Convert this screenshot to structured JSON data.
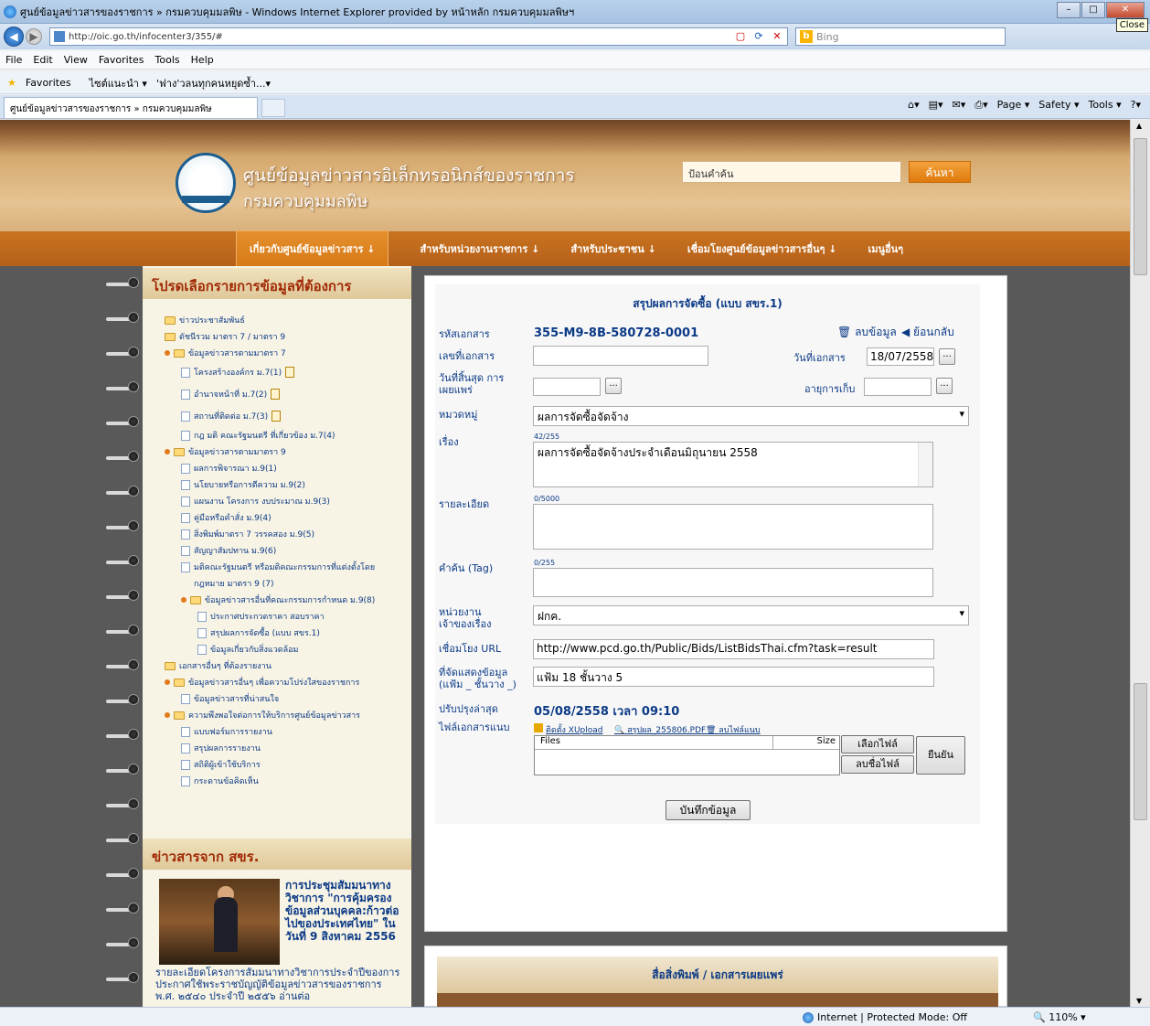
{
  "browser": {
    "window_title": "ศูนย์ข้อมูลข่าวสารของราชการ » กรมควบคุมมลพิษ - Windows Internet Explorer provided by หน้าหลัก กรมควบคุมมลพิษฯ",
    "url": "http://oic.go.th/infocenter3/355/#",
    "search_engine": "Bing",
    "close_tooltip": "Close",
    "menu": [
      "File",
      "Edit",
      "View",
      "Favorites",
      "Tools",
      "Help"
    ],
    "favorites_label": "Favorites",
    "fav_items": [
      "ไซต์แนะนำ ▾",
      "'ฟาง'วลนทุกคนหยุดซ้ำ...▾"
    ],
    "tab_title": "ศูนย์ข้อมูลข่าวสารของราชการ » กรมควบคุมมลพิษ",
    "commands": [
      "Page ▾",
      "Safety ▾",
      "Tools ▾"
    ],
    "status": "Internet | Protected Mode: Off",
    "zoom": "110%"
  },
  "site": {
    "name_line1": "ศูนย์ข้อมูลข่าวสารอิเล็กทรอนิกส์ของราชการ",
    "name_line2": "กรมควบคุมมลพิษ",
    "search_placeholder": "ป้อนคำค้น",
    "search_button": "ค้นหา",
    "nav": [
      "เกี่ยวกับศูนย์ข้อมูลข่าวสาร ↓",
      "สำหรับหน่วยงานราชการ ↓",
      "สำหรับประชาชน ↓",
      "เชื่อมโยงศูนย์ข้อมูลข่าวสารอื่นๆ ↓",
      "เมนูอื่นๆ"
    ]
  },
  "sidebar": {
    "heading": "โปรดเลือกรายการข้อมูลที่ต้องการ",
    "tree": [
      {
        "label": "ข่าวประชาสัมพันธ์",
        "kind": "folder",
        "indent": 0
      },
      {
        "label": "ดัชนีรวม มาตรา 7 / มาตรา 9",
        "kind": "folder",
        "indent": 0
      },
      {
        "label": "ข้อมูลข่าวสารตามมาตรา 7",
        "kind": "folder-open",
        "indent": 0
      },
      {
        "label": "โครงสร้างองค์กร ม.7(1)",
        "kind": "doc",
        "indent": 1,
        "new": true
      },
      {
        "label": "อำนาจหน้าที่ ม.7(2)",
        "kind": "doc",
        "indent": 1,
        "new": true
      },
      {
        "label": "สถานที่ติดต่อ ม.7(3)",
        "kind": "doc",
        "indent": 1,
        "new": true
      },
      {
        "label": "กฎ มติ คณะรัฐมนตรี ที่เกี่ยวข้อง ม.7(4)",
        "kind": "doc",
        "indent": 1
      },
      {
        "label": "ข้อมูลข่าวสารตามมาตรา 9",
        "kind": "folder-open",
        "indent": 0
      },
      {
        "label": "ผลการพิจารณา ม.9(1)",
        "kind": "doc",
        "indent": 1
      },
      {
        "label": "นโยบายหรือการตีความ ม.9(2)",
        "kind": "doc",
        "indent": 1
      },
      {
        "label": "แผนงาน โครงการ งบประมาณ ม.9(3)",
        "kind": "doc",
        "indent": 1
      },
      {
        "label": "คู่มือหรือคำสั่ง ม.9(4)",
        "kind": "doc",
        "indent": 1
      },
      {
        "label": "สิ่งพิมพ์มาตรา 7 วรรคสอง ม.9(5)",
        "kind": "doc",
        "indent": 1
      },
      {
        "label": "สัญญาสัมปทาน ม.9(6)",
        "kind": "doc",
        "indent": 1
      },
      {
        "label": "มติคณะรัฐมนตรี หรือมติคณะกรรมการที่แต่งตั้งโดย",
        "kind": "doc",
        "indent": 1
      },
      {
        "label": "กฎหมาย มาตรา 9 (7)",
        "kind": "text",
        "indent": 1
      },
      {
        "label": "ข้อมูลข่าวสารอื่นที่คณะกรรมการกำหนด ม.9(8)",
        "kind": "folder-open",
        "indent": 1
      },
      {
        "label": "ประกาศประกวดราคา สอบราคา",
        "kind": "doc",
        "indent": 2
      },
      {
        "label": "สรุปผลการจัดซื้อ (แบบ สขร.1)",
        "kind": "doc",
        "indent": 2
      },
      {
        "label": "ข้อมูลเกี่ยวกับสิ่งแวดล้อม",
        "kind": "doc",
        "indent": 2
      },
      {
        "label": "เอกสารอื่นๆ ที่ต้องรายงาน",
        "kind": "folder",
        "indent": 0
      },
      {
        "label": "ข้อมูลข่าวสารอื่นๆ เพื่อความโปร่งใสของราชการ",
        "kind": "folder-open",
        "indent": 0
      },
      {
        "label": "ข้อมูลข่าวสารที่น่าสนใจ",
        "kind": "doc",
        "indent": 1
      },
      {
        "label": "ความพึงพอใจต่อการให้บริการศูนย์ข้อมูลข่าวสาร",
        "kind": "folder-open",
        "indent": 0
      },
      {
        "label": "แบบฟอร์มการรายงาน",
        "kind": "doc",
        "indent": 1
      },
      {
        "label": "สรุปผลการรายงาน",
        "kind": "doc",
        "indent": 1
      },
      {
        "label": "สถิติผู้เข้าใช้บริการ",
        "kind": "doc",
        "indent": 1
      },
      {
        "label": "กระดานข้อคิดเห็น",
        "kind": "doc",
        "indent": 1
      }
    ],
    "news_heading": "ข่าวสารจาก สขร.",
    "news_title": "การประชุมสัมมนาทางวิชาการ \"การคุ้มครองข้อมูลส่วนบุคคล:ก้าวต่อไปของประเทศไทย\" ในวันที่ 9 สิงหาคม 2556",
    "news_body": "รายละเอียดโครงการสัมมนาทางวิชาการประจำปีของการประกาศใช้พระราชบัญญัติข้อมูลข่าวสารของราชการ พ.ศ. ๒๕๔๐ ประจำปี ๒๕๕๖ อ่านต่อ"
  },
  "form": {
    "title": "สรุปผลการจัดซื้อ (แบบ สขร.1)",
    "doc_code_label": "รหัสเอกสาร",
    "doc_code": "355-M9-8B-580728-0001",
    "delete_label": "ลบข้อมูล",
    "back_label": "ย้อนกลับ",
    "doc_no_label": "เลขที่เอกสาร",
    "doc_no": "",
    "doc_date_label": "วันที่เอกสาร",
    "doc_date": "18/07/2558",
    "end_date_label": "วันที่สิ้นสุด การเผยแพร่",
    "end_date": "",
    "retention_label": "อายุการเก็บ",
    "retention": "",
    "category_label": "หมวดหมู่",
    "category": "ผลการจัดซื้อจัดจ้าง",
    "subject_label": "เรื่อง",
    "subject_count": "42/255",
    "subject": "ผลการจัดซื้อจัดจ้างประจำเดือนมิถุนายน 2558",
    "detail_label": "รายละเอียด",
    "detail_count": "0/5000",
    "detail": "",
    "tag_label": "คำค้น (Tag)",
    "tag_count": "0/255",
    "tag": "",
    "owner_label": "หน่วยงาน เจ้าของเรื่อง",
    "owner": "ฝกค.",
    "link_label": "เชื่อมโยง URL",
    "link": "http://www.pcd.go.th/Public/Bids/ListBidsThai.cfm?task=result",
    "location_label": "ที่จัดแสดงข้อมูล (แฟ้ม _ ชั้นวาง _)",
    "location": "แฟ้ม 18 ชั้นวาง 5",
    "updated_label": "ปรับปรุงล่าสุด",
    "updated": "05/08/2558 เวลา 09:10",
    "attach_label": "ไฟล์เอกสารแนบ",
    "attach_links": [
      "ติดตั้ง XUpload",
      "สรุปผล_255806.PDF",
      "ลบไฟล์แนบ"
    ],
    "files_header": "Files",
    "size_header": "Size",
    "choose_file": "เลือกไฟล์",
    "remove_file": "ลบชื่อไฟล์",
    "confirm": "ยืนยัน",
    "save": "บันทึกข้อมูล",
    "pick": "..."
  },
  "publications_heading": "สื่อสิ่งพิมพ์ / เอกสารเผยแพร่",
  "colors": {
    "accent": "#c9741f",
    "heading": "#a02a05",
    "text_blue": "#0b3a86"
  }
}
